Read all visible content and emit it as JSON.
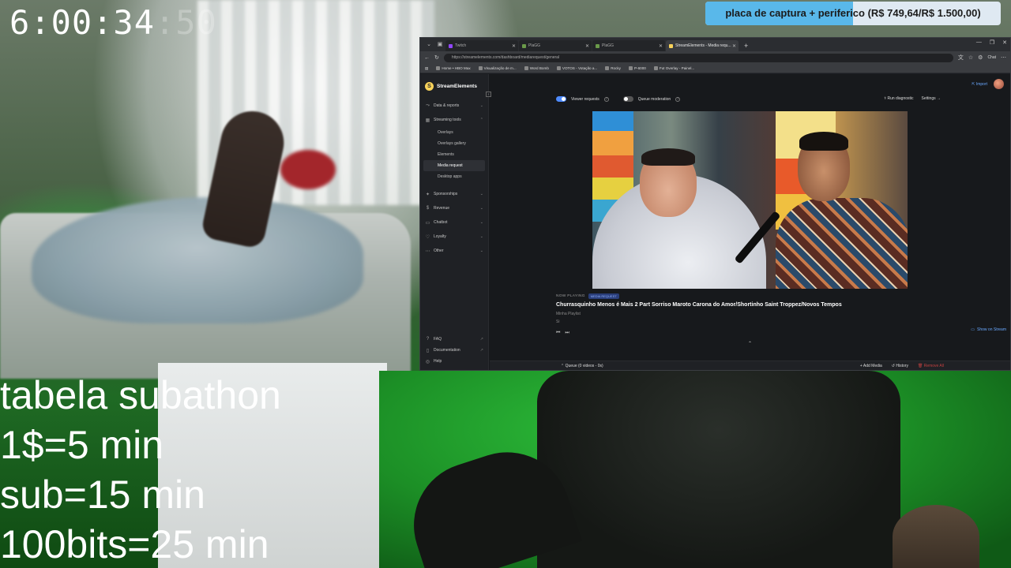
{
  "overlay": {
    "timer": {
      "main": "6:00:34",
      "ms": ":50"
    },
    "goal": {
      "text": "placa de captura + periferico (R$ 749,64/R$ 1.500,00)",
      "progress": 0.4998
    },
    "subathon": [
      "tabela subathon",
      "1$=5 min",
      "sub=15 min",
      "100bits=25 min"
    ]
  },
  "browser": {
    "tabs": [
      {
        "label": "Twitch",
        "color": "#9146ff",
        "active": false
      },
      {
        "label": "PlaGG",
        "color": "#6a9a4a",
        "active": false
      },
      {
        "label": "PlaGG",
        "color": "#6a9a4a",
        "active": false
      },
      {
        "label": "StreamElements - Media requ...",
        "color": "#f8d25a",
        "active": true
      }
    ],
    "url": "https://streamelements.com/dashboard/mediarequest/general",
    "chat_label": "Chat",
    "bookmarks": [
      "Home • HBO Max",
      "Visualização de m...",
      "Word Bomb",
      "VOTOS - Votação a...",
      "Rocky",
      "P-6000",
      "Fut Overlay - Painel..."
    ]
  },
  "app": {
    "brand": "StreamElements",
    "nav": {
      "data_reports": "Data & reports",
      "streaming_tools": "Streaming tools",
      "sub_items": [
        "Overlays",
        "Overlays gallery",
        "Elements",
        "Media request",
        "Desktop apps"
      ],
      "active_sub": "Media request",
      "sponsorships": "Sponsorships",
      "revenue": "Revenue",
      "chatbot": "Chatbot",
      "loyalty": "Loyalty",
      "other": "Other"
    },
    "bottom": {
      "faq": "FAQ",
      "docs": "Documentation",
      "help": "Help"
    },
    "import_label": "Import",
    "controls": {
      "viewer_requests": "Viewer requests",
      "viewer_requests_on": true,
      "queue_moderation": "Queue moderation",
      "queue_moderation_on": false,
      "run_diagnostic": "Run diagnostic",
      "settings": "Settings"
    },
    "now_playing": {
      "label": "NOW PLAYING",
      "badge": "MEDIA REQUEST",
      "title": "Churrasquinho Menos é Mais 2 Part Sorriso Maroto Carona do Amor/Shortinho Saint Troppez/Novos Tempos",
      "playlist": "Minha Playlist",
      "by": "Si",
      "show_on_stream": "Show on Stream"
    },
    "queue": {
      "label": "Queue (0 videos - 0s)",
      "add_media": "Add Media",
      "history": "History",
      "clear": "Remove All"
    }
  }
}
